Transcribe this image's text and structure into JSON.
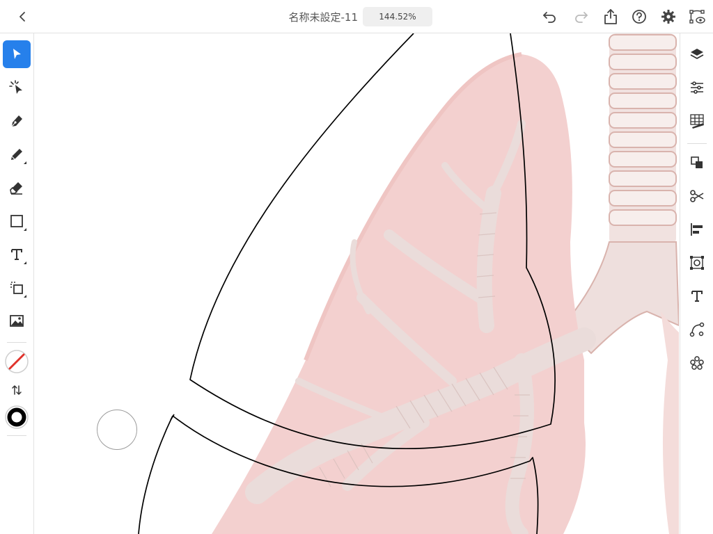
{
  "header": {
    "title": "名称未設定-11",
    "zoom": "144.52%"
  },
  "left_tools": [
    {
      "name": "selection-tool",
      "icon": "arrow-cursor-icon",
      "active": true
    },
    {
      "name": "direct-selection-tool",
      "icon": "sparkle-cursor-icon"
    },
    {
      "name": "pen-tool",
      "icon": "pen-nib-icon"
    },
    {
      "name": "pencil-tool",
      "icon": "pencil-icon"
    },
    {
      "name": "eraser-tool",
      "icon": "eraser-icon"
    },
    {
      "name": "shape-tool",
      "icon": "rectangle-icon"
    },
    {
      "name": "type-tool",
      "icon": "type-icon"
    },
    {
      "name": "rotate-tool",
      "icon": "rotate-square-icon"
    },
    {
      "name": "place-image-tool",
      "icon": "image-icon"
    }
  ],
  "right_tools": [
    "layers-icon",
    "properties-icon",
    "grid-ruler-icon",
    "arrange-icon",
    "scissors-icon",
    "align-icon",
    "transform-icon",
    "text-panel-icon",
    "path-icon",
    "repeat-icon"
  ],
  "colors": {
    "accent": "#2680eb",
    "fill_none_slash": "#e0322b",
    "stroke_swatch": "#000000",
    "lung_tint": "#f3d0cf"
  }
}
